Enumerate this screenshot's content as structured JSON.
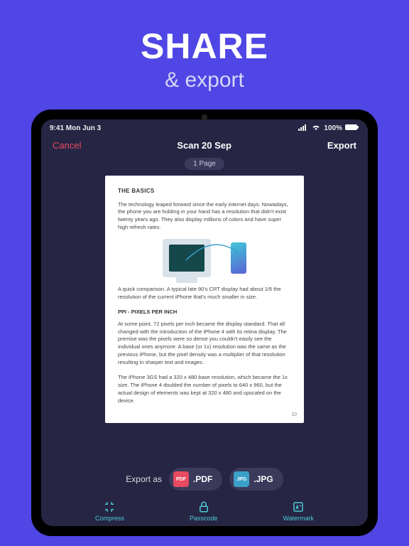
{
  "hero": {
    "title": "SHARE",
    "subtitle": "& export"
  },
  "statusbar": {
    "time": "9:41 Mon Jun 3",
    "battery": "100%"
  },
  "nav": {
    "cancel": "Cancel",
    "title": "Scan 20 Sep",
    "export": "Export"
  },
  "pages_chip": "1 Page",
  "document": {
    "heading_basics": "THE BASICS",
    "p1": "The technology leaped forward since the early internet days. Nowadays, the phone you are holding in your hand has a resolution that didn't exist twenty years ago. They also display millions of colors and have super high refresh rates.",
    "p2": "A quick comparison. A typical late 90's CRT display had about 1/6 the resolution of the current iPhone that's much smaller in size.",
    "heading_ppi": "PPI - PIXELS PER INCH",
    "p3": "At some point, 72 pixels per inch became the display standard. That all changed with the introduction of the iPhone 4 with its retina display. The premise was the pixels were so dense you couldn't easily see the individual ones anymore. A base (or 1x) resolution was the same as the previous iPhone, but the pixel density was a multiplier of that resolution resulting in sharper text and images.",
    "p4": "The iPhone 3GS had a 320 x 480 base resolution, which became the 1x size. The iPhone 4 doubled the number of pixels to 640 x 960, but the actual design of elements was kept at 320 x 480 and upscaled on the device.",
    "page_number": "10"
  },
  "export_row": {
    "label": "Export as",
    "pdf": ".PDF",
    "jpg": ".JPG"
  },
  "bottom": {
    "compress": "Compress",
    "passcode": "Passcode",
    "watermark": "Watermark"
  }
}
